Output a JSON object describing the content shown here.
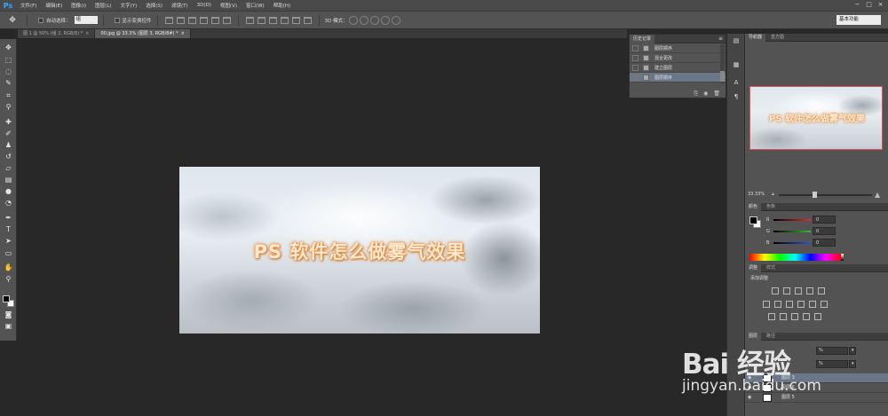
{
  "app": {
    "logo": "Ps"
  },
  "menu": [
    "文件(F)",
    "编辑(E)",
    "图像(I)",
    "图层(L)",
    "文字(Y)",
    "选择(S)",
    "滤镜(T)",
    "3D(D)",
    "视图(V)",
    "窗口(W)",
    "帮助(H)"
  ],
  "window_controls": {
    "minimize": "−",
    "restore": "□",
    "close": "×"
  },
  "options": {
    "auto_select": "自动选择：",
    "auto_select_value": "组",
    "show_transform": "显示变换控件",
    "mode_3d": "3D 模式：",
    "workspace": "基本功能"
  },
  "tabs": [
    {
      "label": "图 1 @ 50% (组 2, RGB/8) *",
      "close": "×"
    },
    {
      "label": "00.jpg @ 33.3% (图层 3, RGB/8#) *",
      "close": "×"
    }
  ],
  "canvas": {
    "title": "PS 软件怎么做雾气效果"
  },
  "history": {
    "tab": "历史记录",
    "menu": "≡",
    "items": [
      "图层顺序",
      "混合更改",
      "建立图层",
      "图层顺序"
    ]
  },
  "navigator": {
    "tabs": [
      "导航器",
      "直方图"
    ],
    "thumb_title": "PS 软件怎么做雾气效果",
    "zoom": "33.33%"
  },
  "color": {
    "tabs": [
      "颜色",
      "色板"
    ],
    "channels": [
      {
        "label": "R",
        "value": "0",
        "color": "#e03030"
      },
      {
        "label": "G",
        "value": "0",
        "color": "#30c030"
      },
      {
        "label": "B",
        "value": "0",
        "color": "#3050e0"
      }
    ]
  },
  "adjustments": {
    "tabs": [
      "调整",
      "样式"
    ],
    "label": "添加调整"
  },
  "layers": {
    "tabs": [
      "图层",
      "路径"
    ],
    "rows": [
      "图层 3",
      "图层 6",
      "图层 5"
    ],
    "opacity_suffix": "%"
  },
  "watermark": {
    "brand": "Bai 经验",
    "url": "jingyan.baidu.com"
  }
}
